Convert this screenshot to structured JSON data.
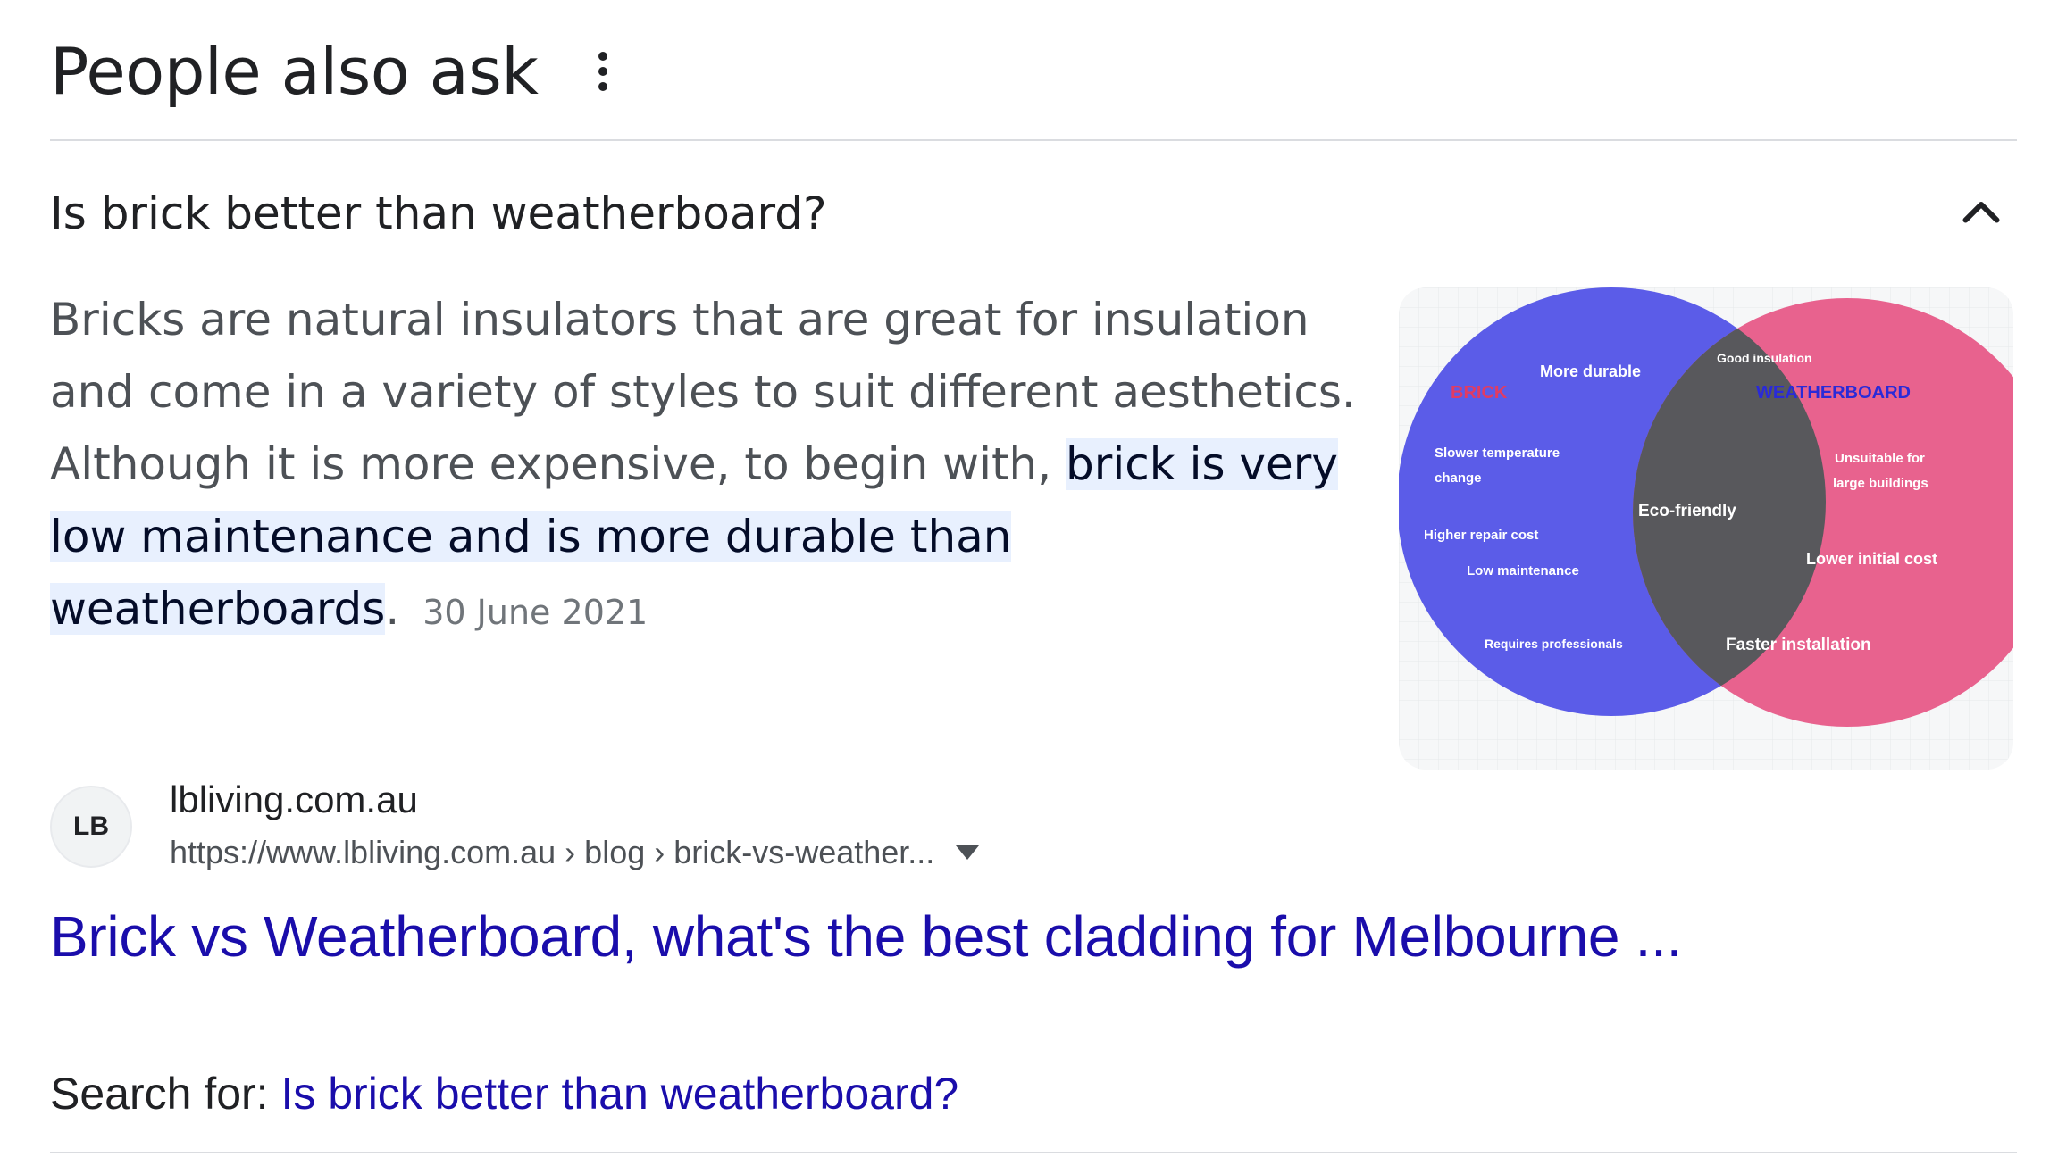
{
  "section": {
    "title": "People also ask",
    "menu_icon": "more-vert-icon"
  },
  "question": {
    "text": "Is brick better than weatherboard?",
    "expanded_icon": "chevron-up-icon"
  },
  "answer": {
    "text_plain_1": "Bricks are natural insulators that are great for insulation and come in a variety of styles to suit different aesthetics. Although it is more expensive, to begin with, ",
    "text_highlight_1": "brick is very",
    "text_highlight_2": "low maintenance and is more durable than",
    "text_highlight_3": "weatherboards",
    "text_after": ".",
    "date": "30 June 2021"
  },
  "venn": {
    "left_title": "BRICK",
    "right_title": "WEATHERBOARD",
    "left_items": [
      "More durable",
      "Slower temperature",
      "change",
      "Higher repair cost",
      "Low maintenance",
      "Requires professionals"
    ],
    "center_item": "Eco-friendly",
    "right_items": [
      "Good insulation",
      "Unsuitable for",
      "large buildings",
      "Lower initial cost",
      "Faster installation"
    ],
    "left_color": "#5b5ce8",
    "right_color": "#e8628e",
    "overlap_color": "#58585c"
  },
  "source": {
    "favicon_text": "LB",
    "site_name": "lbliving.com.au",
    "url": "https://www.lbliving.com.au › blog › brick-vs-weather...",
    "title": "Brick vs Weatherboard, what's the best cladding for Melbourne ..."
  },
  "search_for": {
    "label": "Search for: ",
    "query": "Is brick better than weatherboard?"
  }
}
